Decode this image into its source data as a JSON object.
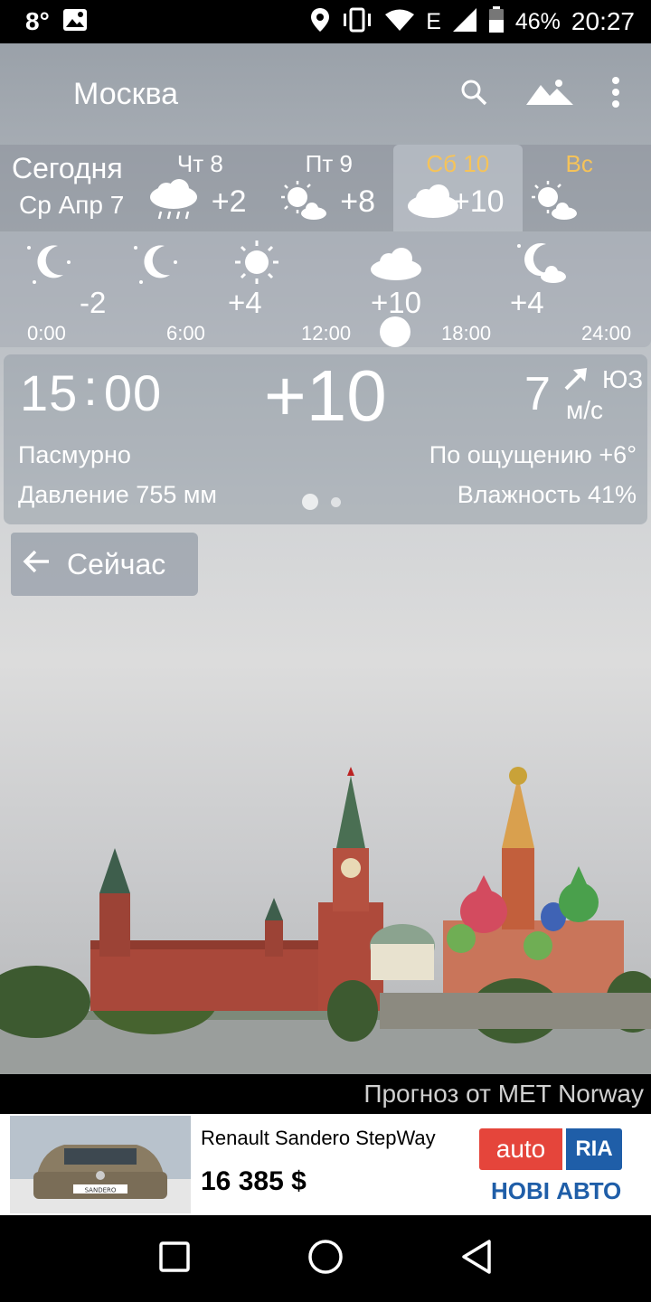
{
  "status_bar": {
    "notification_temp": "8°",
    "battery": "46%",
    "network": "E",
    "time": "20:27",
    "icons": [
      "image-icon",
      "location-icon",
      "vibrate-icon",
      "wifi-icon",
      "signal-icon",
      "battery-icon"
    ]
  },
  "app_bar": {
    "city": "Москва",
    "actions": [
      "search-icon",
      "landscape-icon",
      "more-vert-icon"
    ]
  },
  "days": {
    "today_label": "Сегодня",
    "today_date": "Ср Апр 7",
    "items": [
      {
        "name": "Чт 8",
        "icon": "rain-icon",
        "temp": "+2"
      },
      {
        "name": "Пт 9",
        "icon": "sun-cloud-icon",
        "temp": "+8"
      },
      {
        "name": "Сб 10",
        "icon": "cloud-icon",
        "temp": "+10",
        "selected": true
      },
      {
        "name": "Вс",
        "icon": "sun-cloud-icon",
        "temp": ""
      }
    ]
  },
  "hourly": {
    "icons": [
      "moon-stars-icon",
      "moon-stars-icon",
      "sun-icon",
      "cloud-icon",
      "moon-cloud-icon"
    ],
    "temps": [
      "-2",
      "+4",
      "+10",
      "+4"
    ],
    "times": [
      "0:00",
      "6:00",
      "12:00",
      "18:00",
      "24:00"
    ],
    "selected_time": "15:00"
  },
  "detail": {
    "time_h": "15",
    "time_sep": ":",
    "time_m": "00",
    "temp": "+10",
    "wind_speed": "7",
    "wind_dir": "ЮЗ",
    "wind_unit": "м/с",
    "condition": "Пасмурно",
    "pressure": "Давление 755 мм",
    "feels_like": "По ощущению +6°",
    "humidity": "Влажность 41%",
    "page_count": 2,
    "page_index": 1
  },
  "now_button": {
    "label": "Сейчас"
  },
  "credit": "Прогноз от MET Norway",
  "ad": {
    "title": "Renault Sandero StepWay",
    "price": "16 385 $",
    "logo_auto": "auto",
    "logo_ria": "RIA",
    "subtitle": "НОВІ АВТО",
    "plate": "SANDERO"
  },
  "colors": {
    "selected_day": "#f5c35a",
    "ad_red": "#e5453b",
    "ad_blue": "#1f5ea8"
  }
}
